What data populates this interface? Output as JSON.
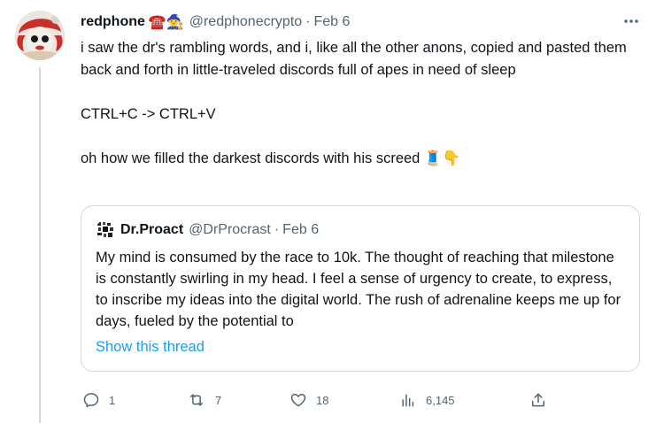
{
  "tweet": {
    "author_name": "redphone",
    "author_emojis": "☎️🧙",
    "handle": "@redphonecrypto",
    "separator": "·",
    "date": "Feb 6",
    "text_lines": [
      "i saw the dr's rambling words, and i, like all the other anons, copied and pasted them back and forth in little-traveled discords full of apes in need of sleep",
      "CTRL+C -> CTRL+V",
      "oh how we filled the darkest discords with his screed 🧵👇"
    ],
    "more_icon": "more-horizontal-icon"
  },
  "quote": {
    "author_name": "Dr.Proact",
    "handle": "@DrProcrast",
    "separator": "·",
    "date": "Feb 6",
    "text": "My mind is consumed by the race to 10k. The thought of reaching that milestone is constantly swirling in my head. I feel a sense of urgency to create, to express, to inscribe my ideas into the digital world. The rush of adrenaline keeps me up for days, fueled by the potential to",
    "link_text": "Show this thread"
  },
  "actions": {
    "replies": "1",
    "retweets": "7",
    "likes": "18",
    "views": "6,145"
  },
  "colors": {
    "link": "#1d9bf0",
    "secondary_text": "#536471",
    "border": "#cfd9de"
  }
}
